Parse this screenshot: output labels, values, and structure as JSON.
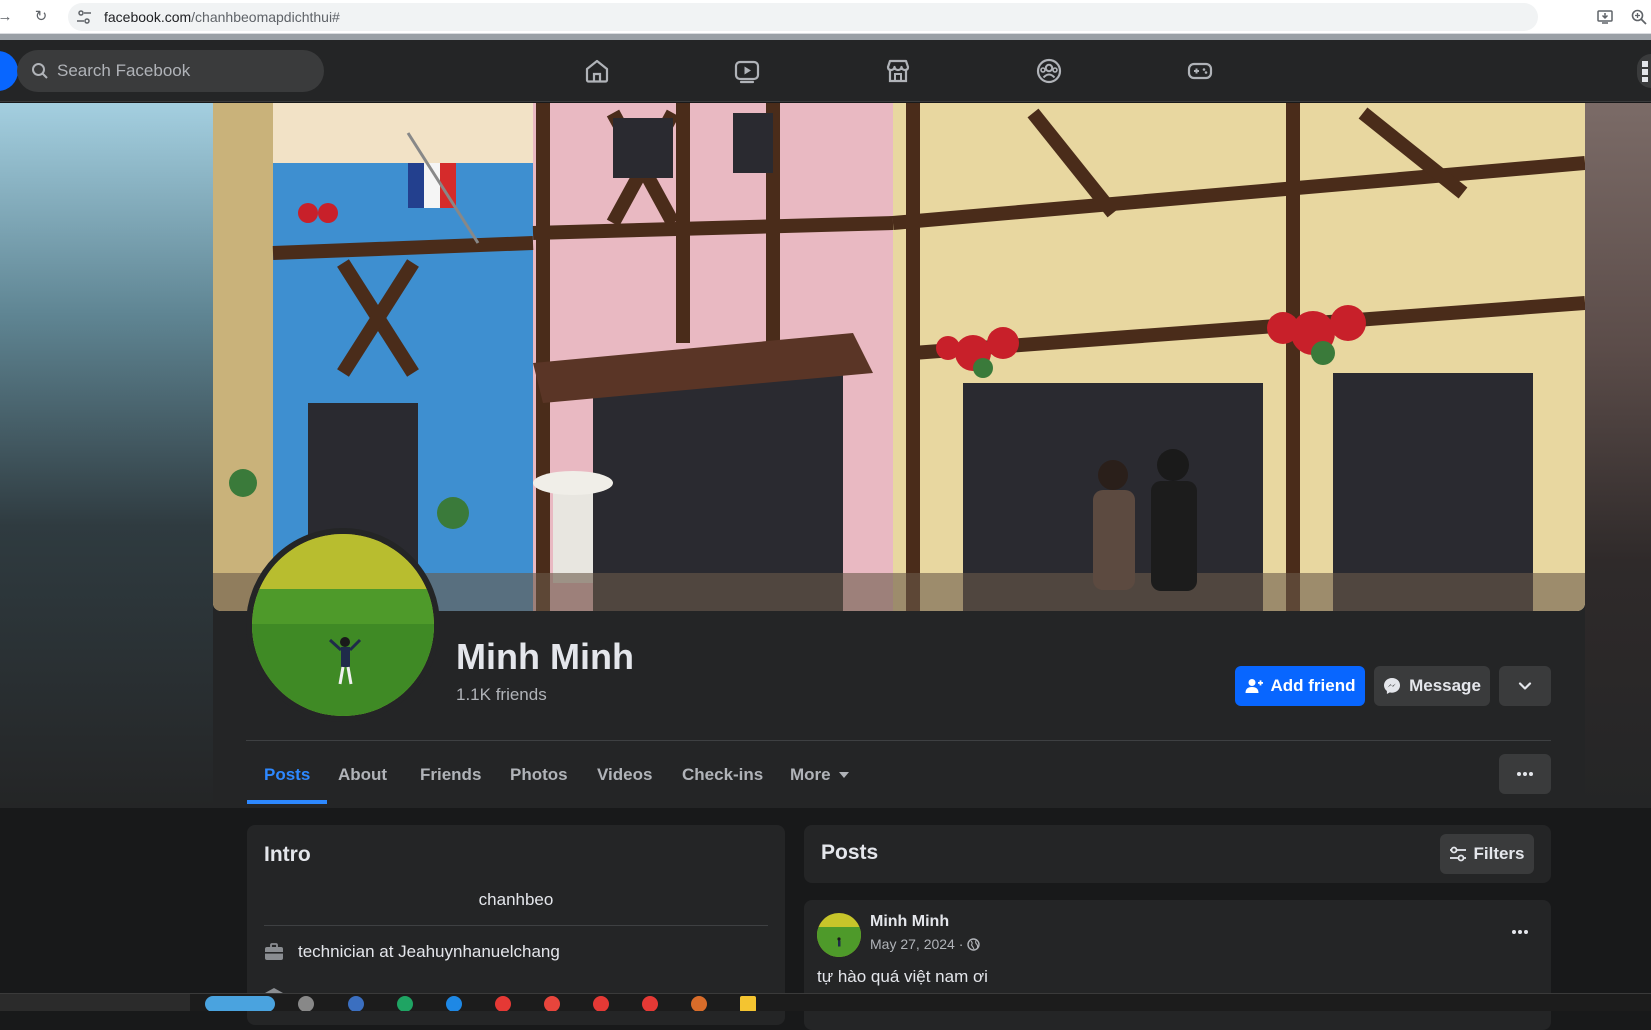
{
  "browser": {
    "url_host": "facebook.com",
    "url_path": "/chanhbeomapdichthui#"
  },
  "header": {
    "search_placeholder": "Search Facebook",
    "nav_tabs": [
      {
        "name": "home-icon"
      },
      {
        "name": "video-icon"
      },
      {
        "name": "marketplace-icon"
      },
      {
        "name": "groups-icon"
      },
      {
        "name": "gaming-icon"
      }
    ]
  },
  "profile": {
    "name": "Minh Minh",
    "friends": "1.1K friends",
    "add_friend_label": "Add friend",
    "message_label": "Message"
  },
  "profile_tabs": [
    {
      "label": "Posts",
      "active": true
    },
    {
      "label": "About"
    },
    {
      "label": "Friends"
    },
    {
      "label": "Photos"
    },
    {
      "label": "Videos"
    },
    {
      "label": "Check-ins"
    },
    {
      "label": "More"
    }
  ],
  "intro": {
    "title": "Intro",
    "bio": "chanhbeo",
    "work": "technician at Jeahuynhanuelchang"
  },
  "posts": {
    "title": "Posts",
    "filters_label": "Filters",
    "items": [
      {
        "author": "Minh Minh",
        "date": "May 27, 2024 ·",
        "text": "tự hào quá việt nam ơi"
      }
    ]
  },
  "colors": {
    "accent": "#0866ff",
    "active_tab": "#2d88ff",
    "surface": "#242526",
    "background": "#18191a"
  }
}
